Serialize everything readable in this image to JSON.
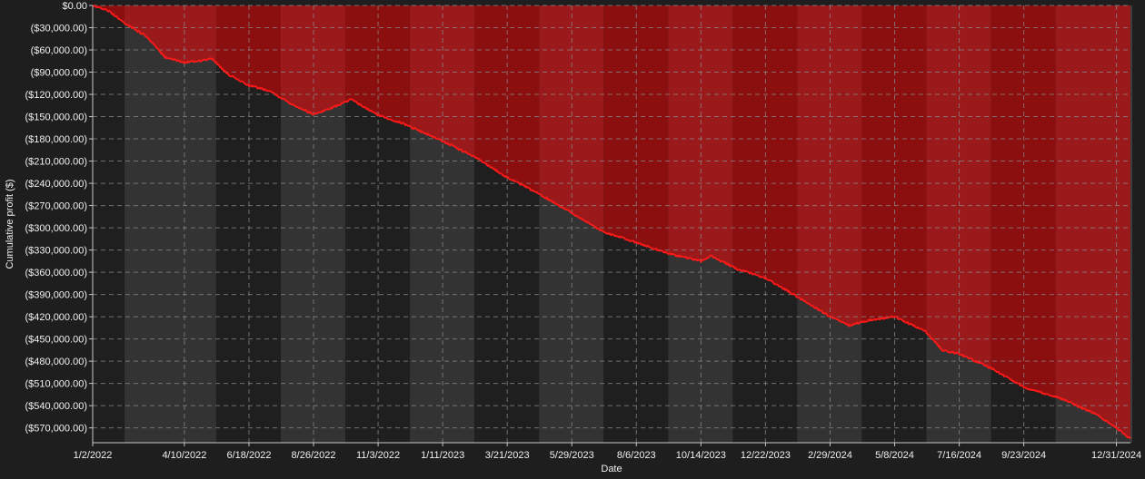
{
  "chart_data": {
    "type": "area",
    "xlabel": "Date",
    "ylabel": "Cumulative profit ($)",
    "x_ticks": [
      "1/2/2022",
      "4/10/2022",
      "6/18/2022",
      "8/26/2022",
      "11/3/2022",
      "1/11/2023",
      "3/21/2023",
      "5/29/2023",
      "8/6/2023",
      "10/14/2023",
      "12/22/2023",
      "2/29/2024",
      "5/8/2024",
      "7/16/2024",
      "9/23/2024",
      "12/31/2024"
    ],
    "y_ticks": [
      "$0.00",
      "($30,000.00)",
      "($60,000.00)",
      "($90,000.00)",
      "($120,000.00)",
      "($150,000.00)",
      "($180,000.00)",
      "($210,000.00)",
      "($240,000.00)",
      "($270,000.00)",
      "($300,000.00)",
      "($330,000.00)",
      "($360,000.00)",
      "($390,000.00)",
      "($420,000.00)",
      "($450,000.00)",
      "($480,000.00)",
      "($510,000.00)",
      "($540,000.00)",
      "($570,000.00)"
    ],
    "ylim": [
      -590000,
      0
    ],
    "grid": true,
    "colors": {
      "background": "#1e1e1e",
      "band_dark": "#1f1f1f",
      "band_light": "#333333",
      "loss_fill_a": "#8c0f10",
      "loss_fill_b": "#9a1a1b",
      "line": "#ff1a1a",
      "grid": "#8a8a8a",
      "text": "#f0f0f0"
    },
    "series": [
      {
        "x": [
          "2022-01-02",
          "2022-01-20",
          "2022-02-10",
          "2022-03-01",
          "2022-03-20",
          "2022-04-10",
          "2022-04-25",
          "2022-05-10",
          "2022-05-25",
          "2022-06-18",
          "2022-07-10",
          "2022-08-01",
          "2022-08-26",
          "2022-09-15",
          "2022-10-05",
          "2022-11-03",
          "2022-12-01",
          "2023-01-11",
          "2023-02-15",
          "2023-03-21",
          "2023-04-25",
          "2023-05-29",
          "2023-07-01",
          "2023-08-06",
          "2023-09-10",
          "2023-10-14",
          "2023-10-25",
          "2023-11-20",
          "2023-12-22",
          "2024-01-25",
          "2024-02-29",
          "2024-03-20",
          "2024-04-10",
          "2024-05-08",
          "2024-06-10",
          "2024-06-28",
          "2024-07-16",
          "2024-08-20",
          "2024-09-23",
          "2024-11-01",
          "2024-12-10",
          "2024-12-31",
          "2025-01-15"
        ],
        "y": [
          0,
          -8000,
          -28000,
          -42000,
          -70000,
          -77000,
          -75000,
          -72000,
          -92000,
          -108000,
          -115000,
          -132000,
          -147000,
          -138000,
          -127000,
          -148000,
          -160000,
          -183000,
          -205000,
          -232000,
          -255000,
          -280000,
          -305000,
          -320000,
          -335000,
          -345000,
          -338000,
          -355000,
          -368000,
          -393000,
          -420000,
          -432000,
          -425000,
          -420000,
          -440000,
          -465000,
          -470000,
          -490000,
          -515000,
          -530000,
          -552000,
          -570000,
          -585000
        ]
      }
    ]
  }
}
